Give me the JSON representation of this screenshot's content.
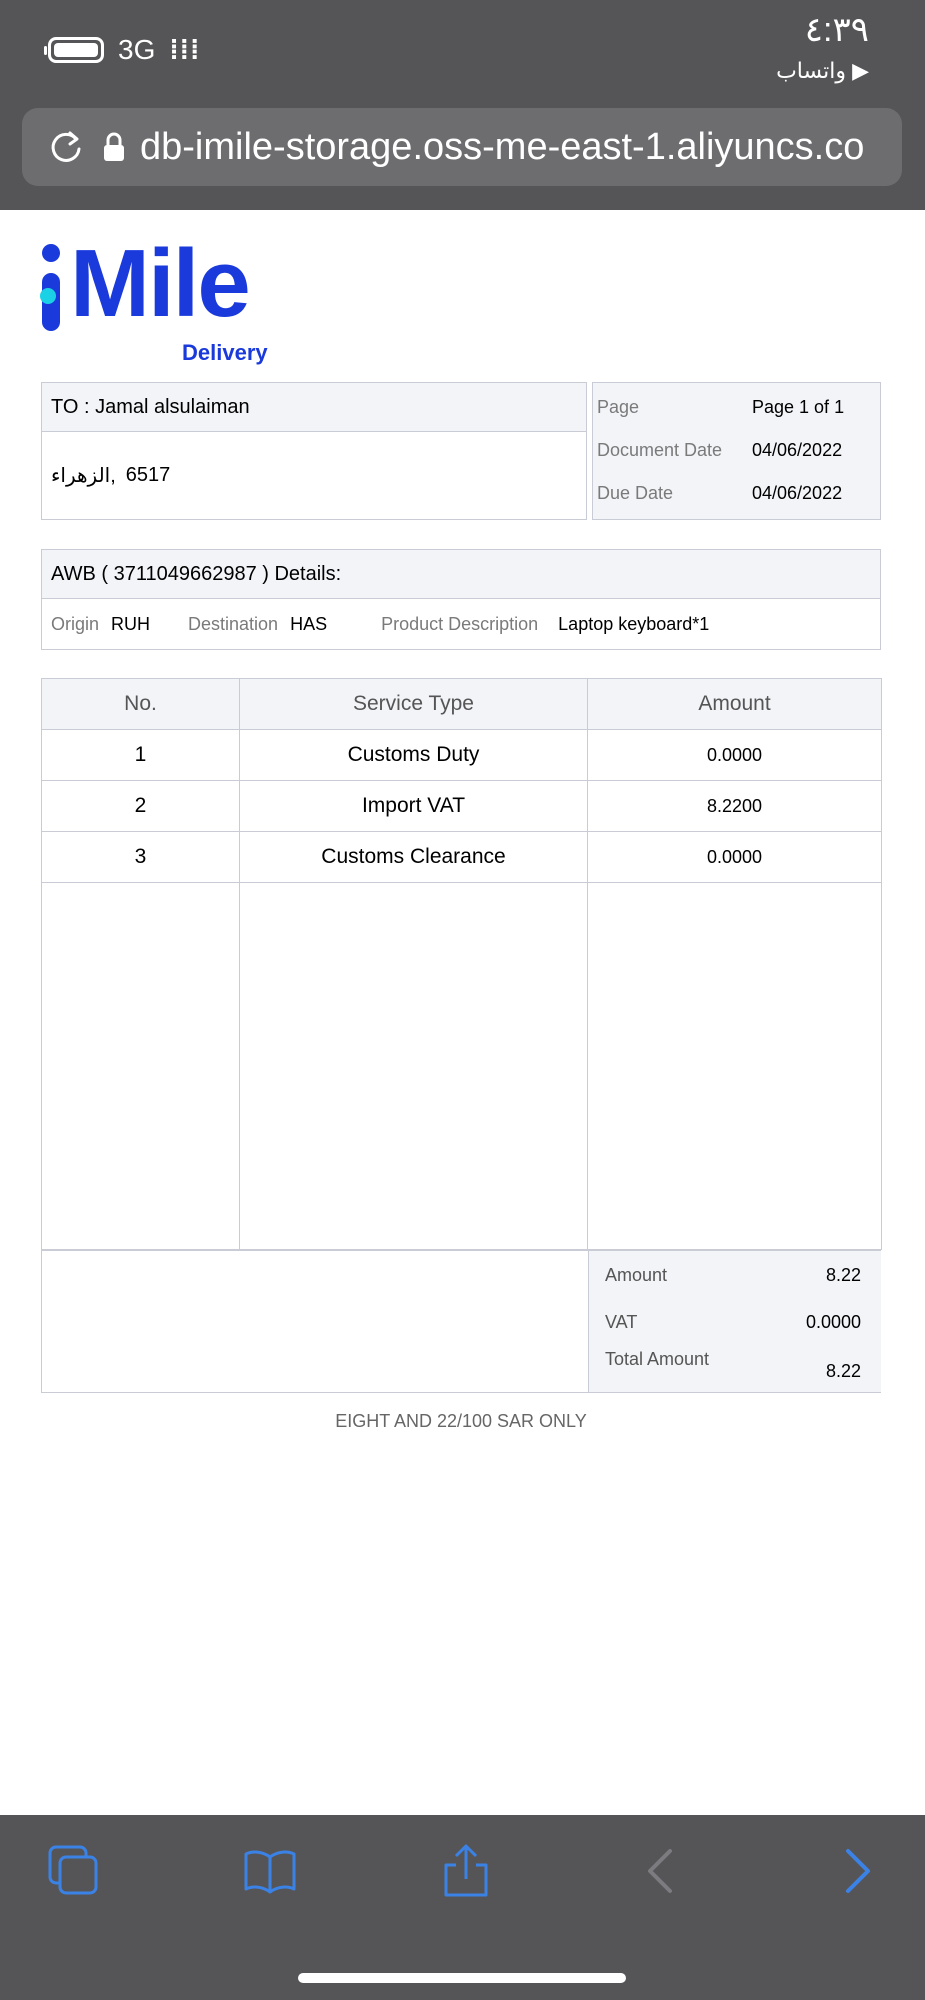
{
  "status_bar": {
    "network": "3G",
    "time": "٤:٣٩",
    "back_app": "▶ واتساب"
  },
  "browser": {
    "url": "db-imile-storage.oss-me-east-1.aliyuncs.co"
  },
  "logo": {
    "wordmark": "Mile",
    "subtitle": "Delivery"
  },
  "recipient": {
    "to_line": "TO : Jamal alsulaiman",
    "address_number": "6517",
    "address_text": "الزهراء,"
  },
  "meta": {
    "page_label": "Page",
    "page_value": "Page 1 of 1",
    "doc_date_label": "Document Date",
    "doc_date_value": "04/06/2022",
    "due_date_label": "Due Date",
    "due_date_value": "04/06/2022"
  },
  "awb": {
    "heading": "AWB ( 3711049662987 ) Details:",
    "origin_label": "Origin",
    "origin_value": "RUH",
    "destination_label": "Destination",
    "destination_value": "HAS",
    "product_label": "Product Description",
    "product_value": "Laptop keyboard*1"
  },
  "services": {
    "headers": [
      "No.",
      "Service Type",
      "Amount"
    ],
    "rows": [
      {
        "no": "1",
        "service": "Customs Duty",
        "amount": "0.0000"
      },
      {
        "no": "2",
        "service": "Import VAT",
        "amount": "8.2200"
      },
      {
        "no": "3",
        "service": "Customs Clearance",
        "amount": "0.0000"
      }
    ]
  },
  "totals": {
    "amount_label": "Amount",
    "amount_value": "8.22",
    "vat_label": "VAT",
    "vat_value": "0.0000",
    "total_label": "Total Amount",
    "total_value": "8.22"
  },
  "amount_in_words": "EIGHT  AND 22/100 SAR ONLY",
  "colors": {
    "brand": "#1a3adb",
    "brand_accent": "#1ad1e6",
    "toolbar_icon": "#3b82e6"
  }
}
